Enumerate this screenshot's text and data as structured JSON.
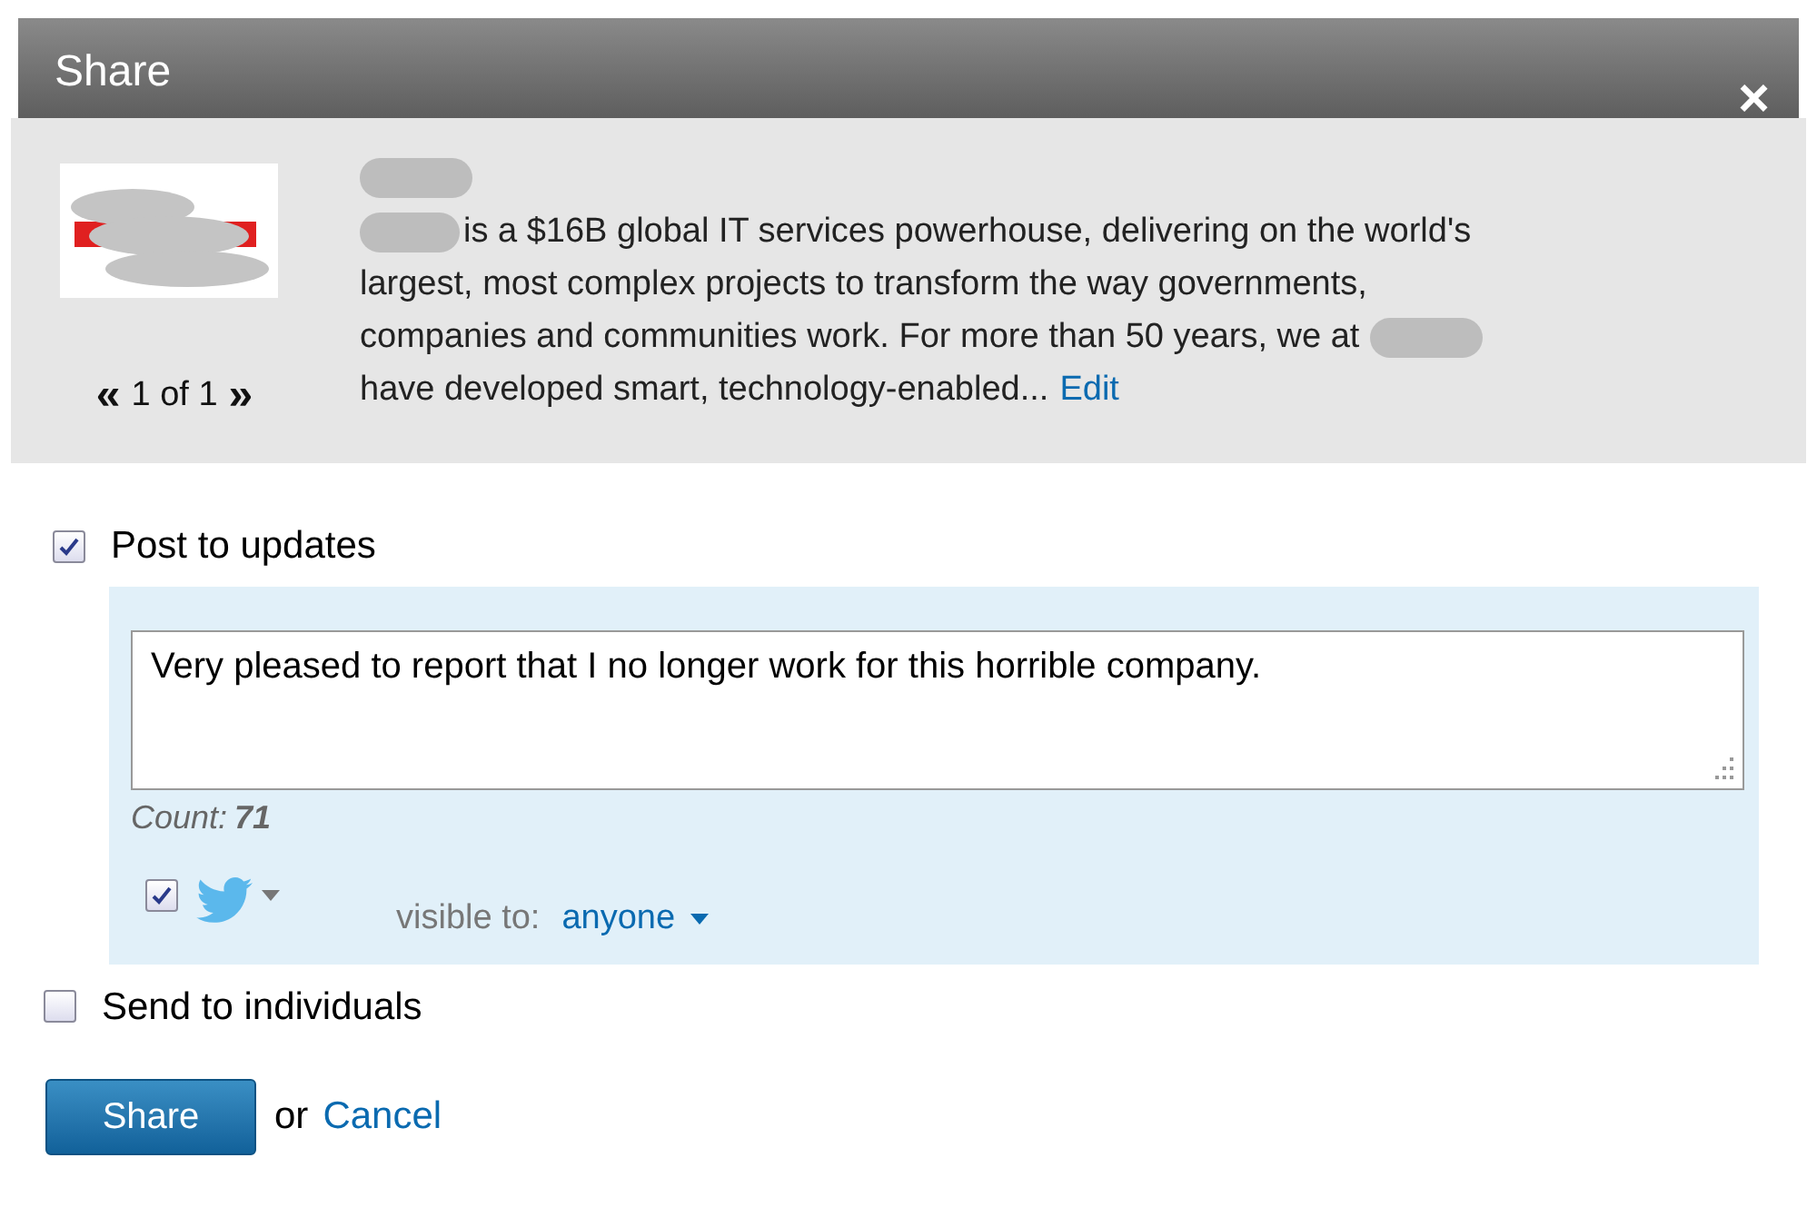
{
  "dialog": {
    "title": "Share",
    "close": "×"
  },
  "preview": {
    "pager": {
      "prev": "«",
      "label": "1 of 1",
      "next": "»"
    },
    "description_lines": [
      "is a $16B global IT services powerhouse, delivering on the world's",
      "largest, most complex projects to transform the way governments,",
      "companies and communities work. For more than 50 years, we at",
      "have developed smart, technology-enabled..."
    ],
    "edit_link": "Edit"
  },
  "post_to_updates": {
    "label": "Post to updates",
    "checked": true,
    "message": "Very pleased to report that I no longer work for this horrible company.",
    "count_label": "Count:",
    "count": "71",
    "twitter_checked": true,
    "visible_label": "visible to:",
    "visibility": "anyone"
  },
  "send_to_individuals": {
    "label": "Send to individuals",
    "checked": false
  },
  "actions": {
    "share": "Share",
    "or": "or",
    "cancel": "Cancel"
  }
}
